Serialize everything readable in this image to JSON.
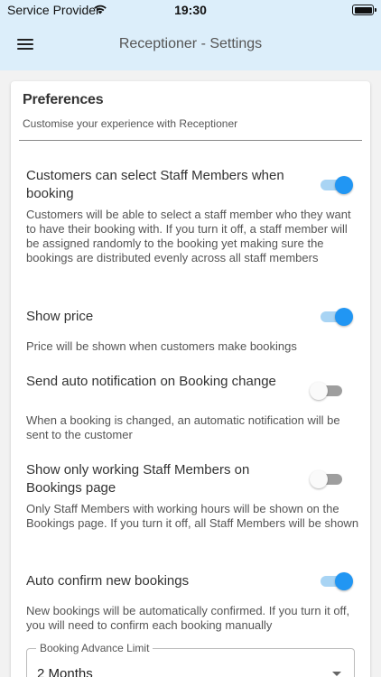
{
  "status_bar": {
    "carrier": "Service Provider",
    "time": "19:30",
    "wifi_icon": "wifi-icon",
    "battery_icon": "battery-icon"
  },
  "header": {
    "menu_icon": "hamburger-menu-icon",
    "title": "Receptioner - Settings",
    "background": "#dceefa"
  },
  "preferences": {
    "title": "Preferences",
    "subtitle": "Customise your experience with Receptioner",
    "settings": [
      {
        "title": "Customers can select Staff Members when booking",
        "description": "Customers will be able to select a staff member who they want to have their booking with. If you turn it off, a staff member will be assigned randomly to the booking yet making sure the bookings are distributed evenly across all staff members",
        "enabled": true
      },
      {
        "title": "Show price",
        "description": "Price will be shown when customers make bookings",
        "enabled": true
      },
      {
        "title": "Send auto notification on Booking change",
        "description": "When a booking is changed, an automatic notification will be sent to the customer",
        "enabled": false
      },
      {
        "title": "Show only working Staff Members on Bookings page",
        "description": "Only Staff Members with working hours will be shown on the Bookings page. If you turn it off, all Staff Members will be shown",
        "enabled": false
      },
      {
        "title": "Auto confirm new bookings",
        "description": "New bookings will be automatically confirmed. If you turn it off, you will need to confirm each booking manually",
        "enabled": true
      }
    ],
    "advance_limit": {
      "label": "Booking Advance Limit",
      "value": "2 Months"
    }
  },
  "colors": {
    "accent": "#2196f3",
    "accent_track": "#a8d4f4",
    "toggle_off_track": "#9e9e9e"
  }
}
